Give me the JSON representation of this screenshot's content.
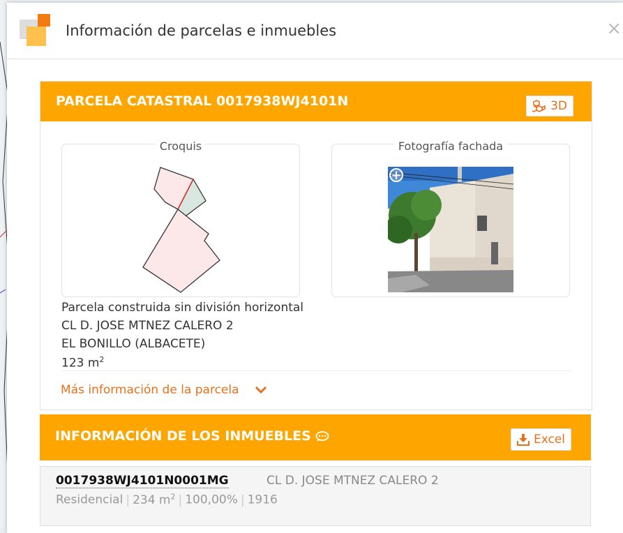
{
  "dialog": {
    "title": "Información de parcelas e inmuebles",
    "close_label": "×"
  },
  "parcela": {
    "title": "PARCELA CATASTRAL 0017938WJ4101N",
    "btn_3d": "3D",
    "croquis_label": "Croquis",
    "foto_label": "Fotografía fachada",
    "tipo": "Parcela construida sin división horizontal",
    "direccion": "CL D. JOSE MTNEZ CALERO 2",
    "municipio": "EL BONILLO (ALBACETE)",
    "superficie_value": "123 m",
    "superficie_sup": "2",
    "more_link": "Más información de la parcela"
  },
  "inmuebles": {
    "title": "INFORMACIÓN DE LOS INMUEBLES",
    "excel_label": "Excel",
    "items": [
      {
        "referencia": "0017938WJ4101N0001MG",
        "direccion": "CL D. JOSE MTNEZ CALERO 2",
        "uso": "Residencial",
        "superficie": "234 m",
        "superficie_sup": "2",
        "participacion": "100,00%",
        "anio": "1916"
      }
    ]
  },
  "colors": {
    "accent": "#ffa500",
    "link": "#e8711b"
  }
}
